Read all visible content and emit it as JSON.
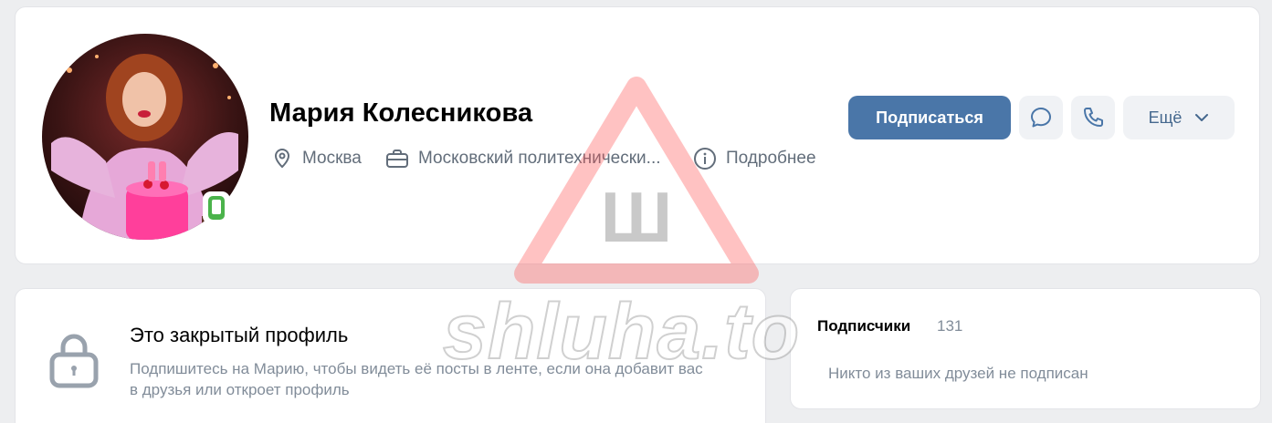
{
  "profile": {
    "name": "Мария Колесникова",
    "city": "Москва",
    "work": "Московский политехнически...",
    "more_info": "Подробнее"
  },
  "actions": {
    "subscribe": "Подписаться",
    "more": "Ещё"
  },
  "closed_profile": {
    "title": "Это закрытый профиль",
    "text": "Подпишитесь на Марию, чтобы видеть её посты в ленте, если она добавит вас в друзья или откроет профиль"
  },
  "followers": {
    "title": "Подписчики",
    "count": "131",
    "empty_text": "Никто из ваших друзей не подписан"
  },
  "watermark": {
    "text": "shluha.to",
    "letter": "Ш"
  },
  "colors": {
    "accent": "#4a76a8",
    "online": "#4bb34b",
    "muted_text": "#818c99"
  },
  "icons": [
    "map-pin-icon",
    "briefcase-icon",
    "info-icon",
    "message-icon",
    "phone-icon",
    "chevron-down-icon",
    "lock-icon",
    "online-mobile-icon"
  ]
}
